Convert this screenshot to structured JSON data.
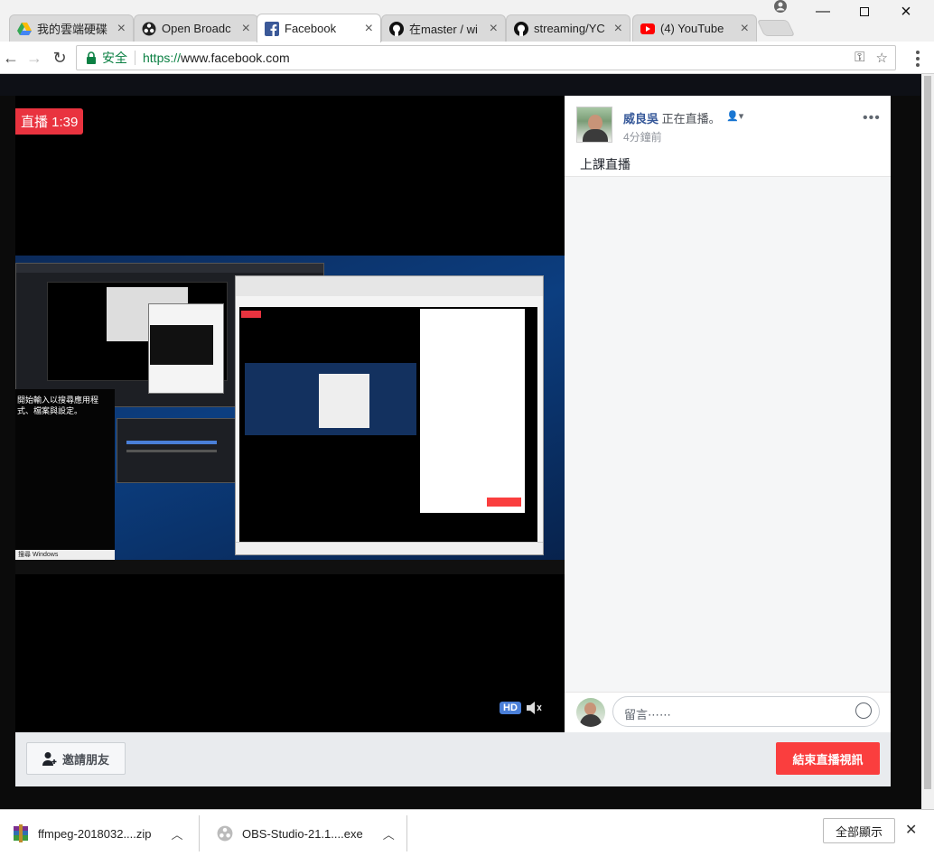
{
  "browser": {
    "tabs": [
      {
        "title": "我的雲端硬碟",
        "icon": "google-drive-icon"
      },
      {
        "title": "Open Broadc",
        "icon": "obs-icon"
      },
      {
        "title": "Facebook",
        "icon": "facebook-icon",
        "active": true
      },
      {
        "title": "在master / wi",
        "icon": "github-icon"
      },
      {
        "title": "streaming/YC",
        "icon": "github-icon"
      },
      {
        "title": "(4) YouTube",
        "icon": "youtube-icon"
      }
    ],
    "secure_label": "安全",
    "url_scheme": "https://",
    "url_host": "www.facebook.com"
  },
  "live": {
    "badge": "直播 1:39",
    "hd": "HD",
    "screen_note": "開始輸入以搜尋應用程式、檔案與設定。",
    "screen_search": "搜尋 Windows"
  },
  "post": {
    "author": "威良吳",
    "status": "正在直播。",
    "time": "4分鐘前",
    "text": "上課直播"
  },
  "comment": {
    "placeholder": "留言⋯⋯"
  },
  "actions": {
    "invite": "邀請朋友",
    "end_live": "結束直播視訊"
  },
  "downloads": [
    {
      "name": "ffmpeg-2018032....zip"
    },
    {
      "name": "OBS-Studio-21.1....exe"
    }
  ],
  "shelf": {
    "show_all": "全部顯示"
  },
  "colors": {
    "live_red": "#e9333f",
    "end_button": "#fa3e3e",
    "fb_link": "#365899",
    "secure_green": "#0b8043"
  }
}
